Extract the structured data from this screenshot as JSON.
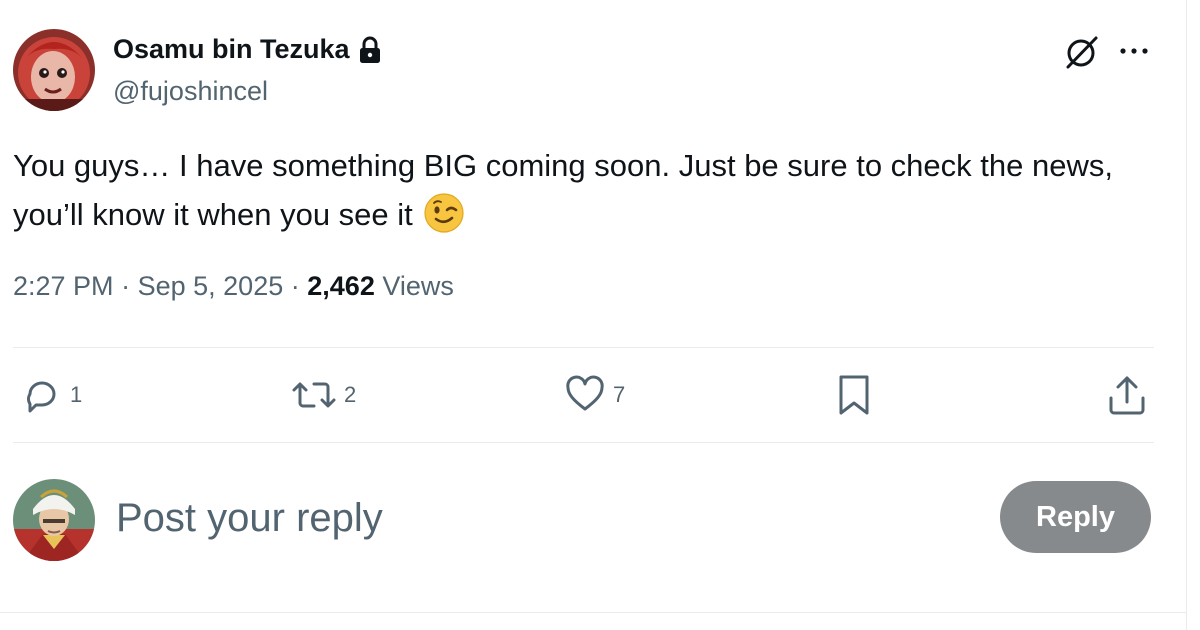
{
  "tweet": {
    "author": {
      "name": "Osamu bin Tezuka",
      "handle": "@fujoshincel",
      "protected_icon": "lock-icon"
    },
    "text": "You guys… I have something BIG coming soon. Just be sure to check the news, you’ll know it when you see it",
    "emoji": "winking-face",
    "time": "2:27 PM",
    "separator": "·",
    "date": "Sep 5, 2025",
    "views_count": "2,462",
    "views_label": "Views"
  },
  "actions": {
    "replies": "1",
    "reposts": "2",
    "likes": "7"
  },
  "reply_box": {
    "placeholder": "Post your reply",
    "button_label": "Reply"
  },
  "colors": {
    "text_primary": "#0f1419",
    "text_secondary": "#536471",
    "divider": "#e8ecef",
    "reply_button_bg": "#878a8d"
  }
}
